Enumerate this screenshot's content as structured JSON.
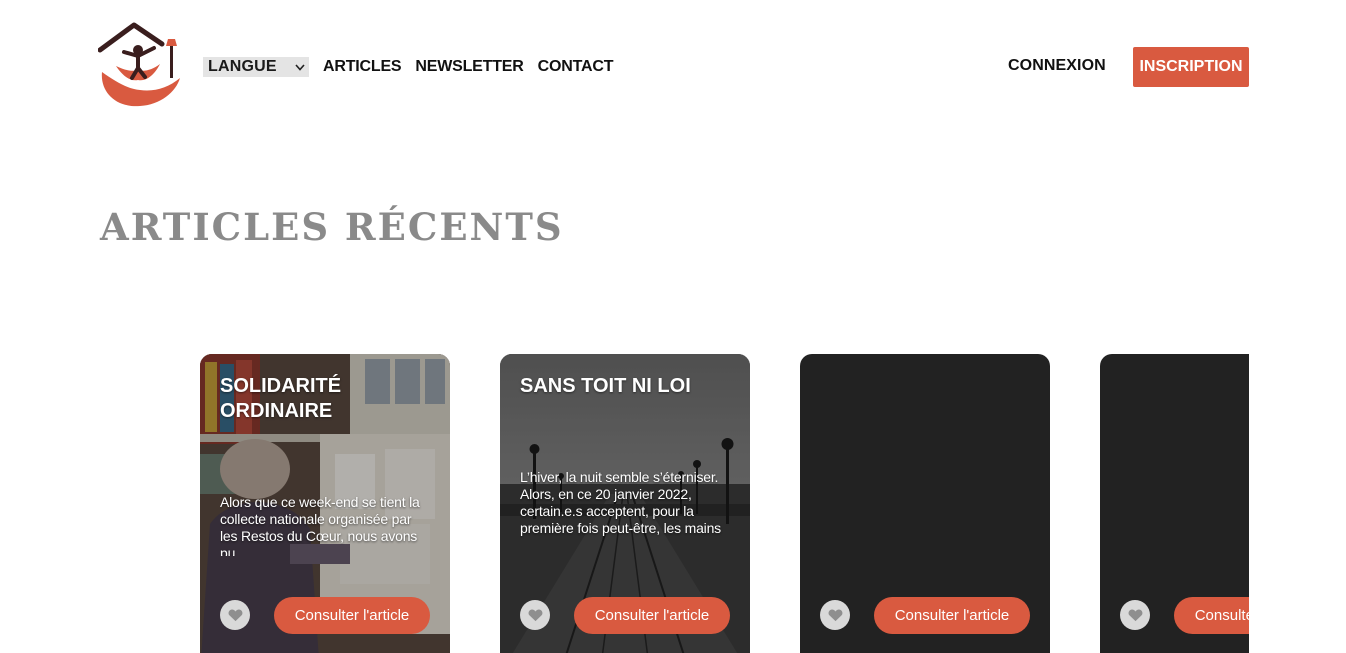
{
  "header": {
    "logo_icon": "hand-house-person-logo",
    "language_label": "LANGUE",
    "nav": [
      "ARTICLES",
      "NEWSLETTER",
      "CONTACT"
    ],
    "login_label": "CONNEXION",
    "signup_label": "INSCRIPTION"
  },
  "colors": {
    "accent": "#d95a40",
    "title_gray": "#8a8a8a",
    "card_dark": "#222222",
    "like_bg": "#d9d9d9"
  },
  "section": {
    "title": "ARTICLES RÉCENTS"
  },
  "articles": [
    {
      "title": "SOLIDARITÉ ORDINAIRE",
      "excerpt": "Alors que ce week-end se tient la collecte nationale organisée par les Restos du Cœur, nous avons pu",
      "cta": "Consulter l'article",
      "like_icon": "heart-icon"
    },
    {
      "title": "SANS TOIT NI LOI",
      "excerpt": "L’hiver, la nuit semble s’éterniser. Alors, en ce 20 janvier 2022, certain.e.s acceptent, pour la première fois peut-être, les mains",
      "cta": "Consulter l'article",
      "like_icon": "heart-icon"
    },
    {
      "title": "",
      "excerpt": "",
      "cta": "Consulter l'article",
      "like_icon": "heart-icon"
    },
    {
      "title": "",
      "excerpt": "",
      "cta": "Consulter l'article",
      "like_icon": "heart-icon"
    }
  ]
}
